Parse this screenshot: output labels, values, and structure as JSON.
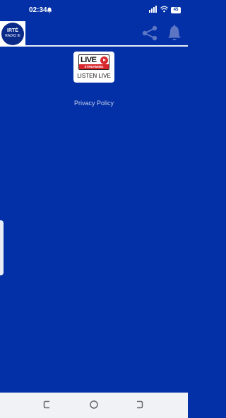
{
  "status_bar": {
    "time": "02:34",
    "battery": "45"
  },
  "app_bar": {
    "logo": {
      "line1": "IRTÉ",
      "line2": "RADIO III"
    }
  },
  "main": {
    "live_button": {
      "badge_word": "LIVE",
      "badge_strip": "STREAMING",
      "label": "LISTEN LIVE"
    },
    "privacy_link": "Privacy Policy"
  },
  "colors": {
    "background": "#0330a6",
    "text_light": "#c8d1ef",
    "accent_red": "#d8262c",
    "nav_bar": "#f1f2f6"
  },
  "icons": [
    "bell-icon",
    "signal-icon",
    "wifi-icon",
    "share-icon",
    "notification-bell-icon",
    "back-icon",
    "home-icon",
    "recents-icon"
  ]
}
